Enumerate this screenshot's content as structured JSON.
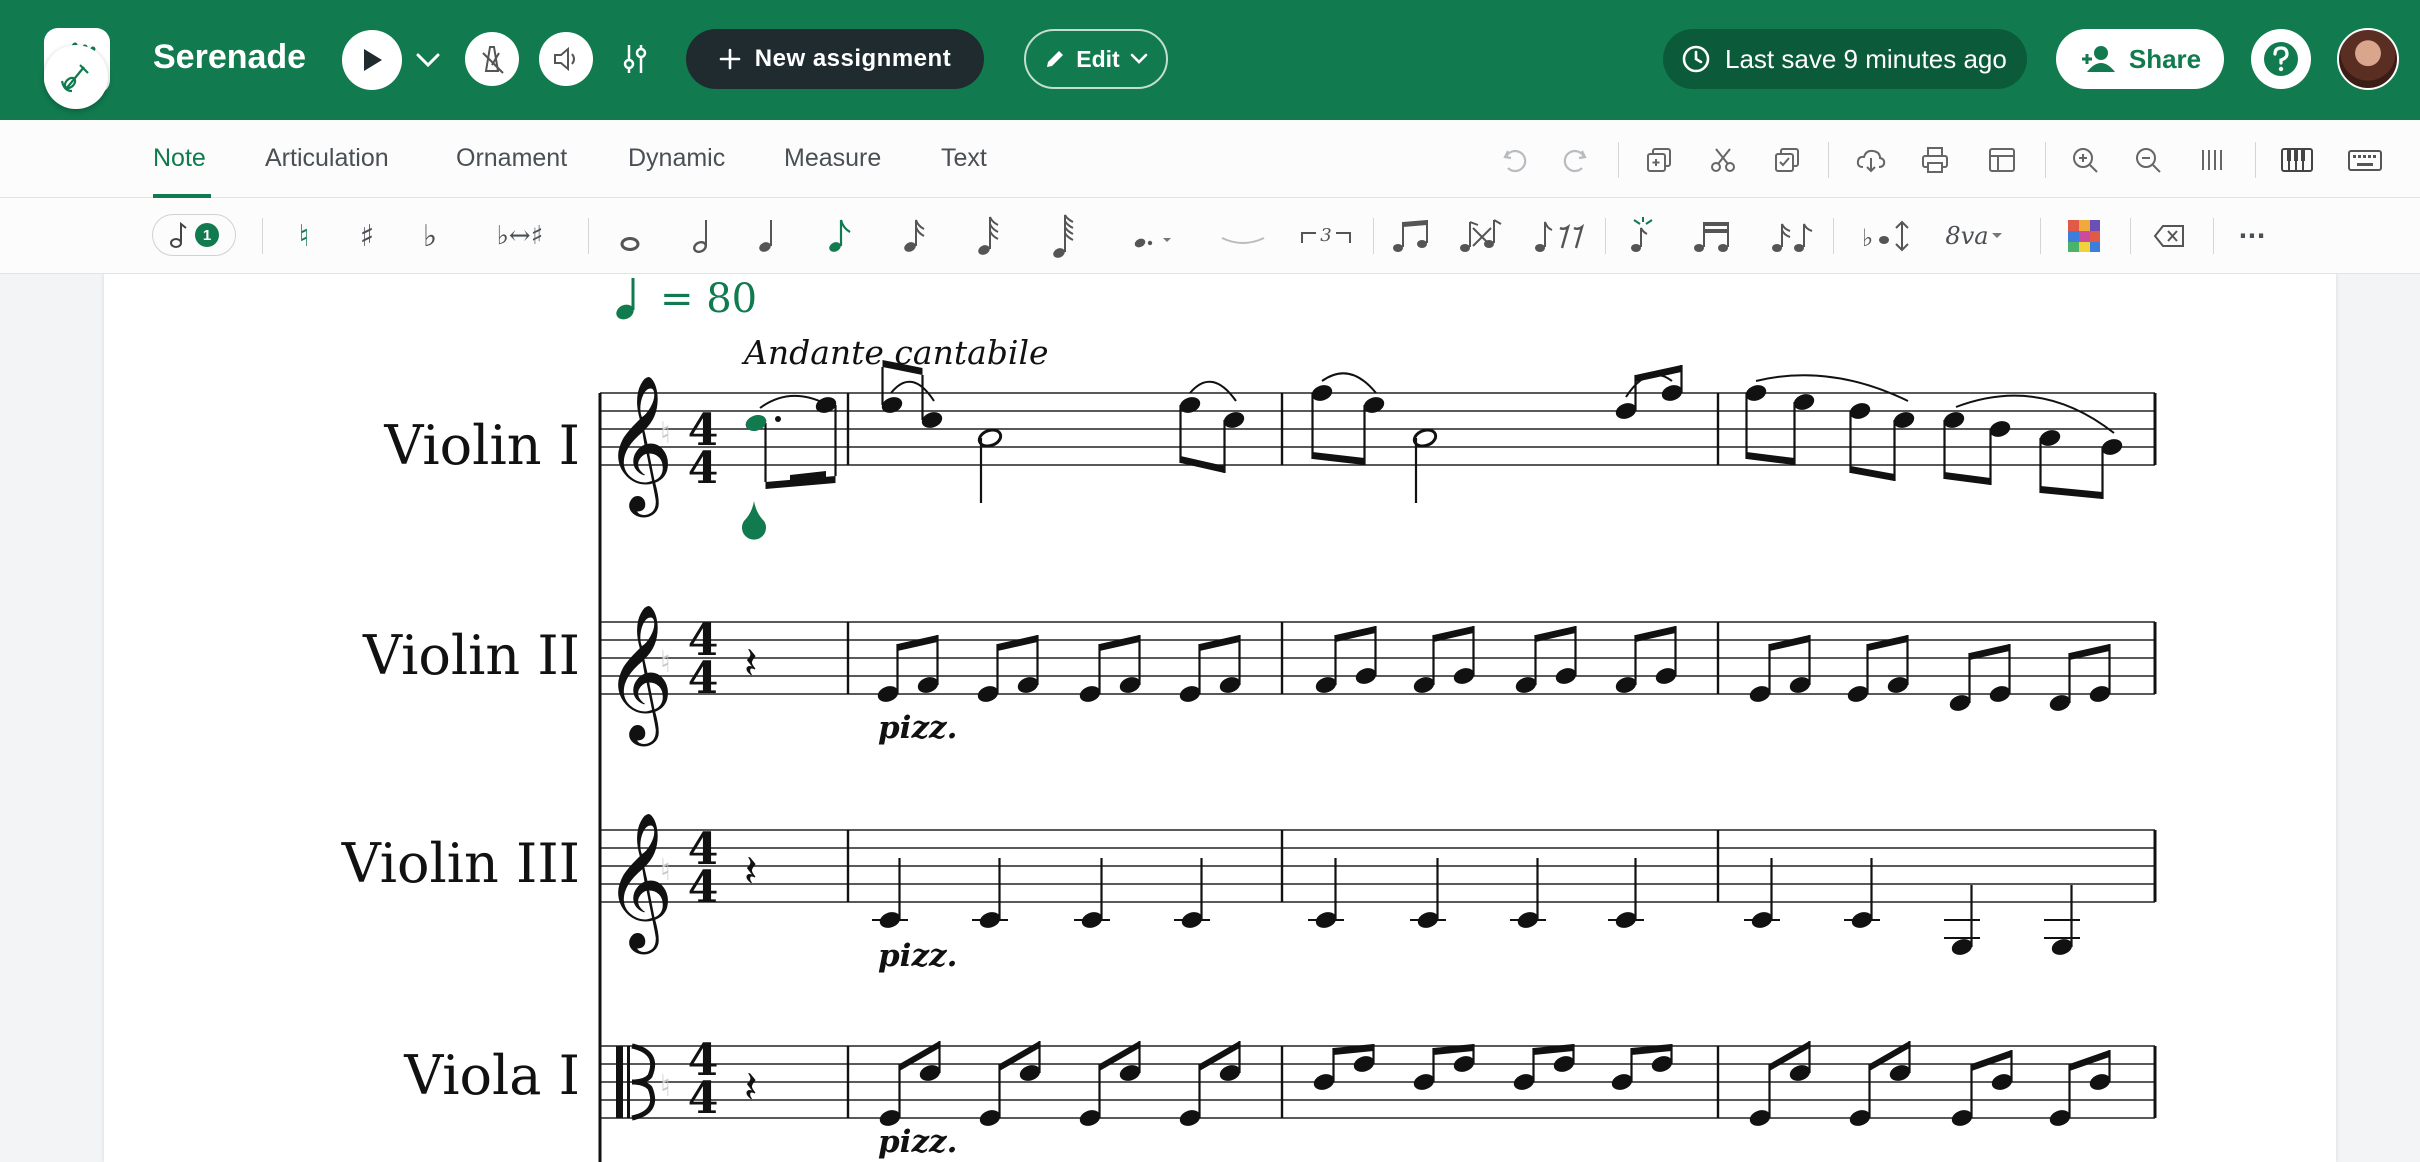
{
  "topbar": {
    "title": "Serenade",
    "new_assignment_label": "New assignment",
    "edit_label": "Edit",
    "save_status": "Last save 9 minutes ago",
    "share_label": "Share",
    "colors": {
      "bar": "#117a4f",
      "dark_button": "#1f2b2f"
    }
  },
  "tabs": [
    {
      "label": "Note",
      "active": true
    },
    {
      "label": "Articulation",
      "active": false
    },
    {
      "label": "Ornament",
      "active": false
    },
    {
      "label": "Dynamic",
      "active": false
    },
    {
      "label": "Measure",
      "active": false
    },
    {
      "label": "Text",
      "active": false
    }
  ],
  "note_toolbar": {
    "voice_number": "1",
    "enharmonic_label": "♭↔♯",
    "tuplet_label": "3",
    "ottava_label": "8va",
    "more_label": "···"
  },
  "score": {
    "tempo": "= 80",
    "expression": "Andante cantabile",
    "instruments": [
      "Violin I",
      "Violin II",
      "Violin III",
      "Viola I"
    ],
    "time_signature": {
      "top": "4",
      "bottom": "4"
    },
    "pizz": "pizz."
  }
}
